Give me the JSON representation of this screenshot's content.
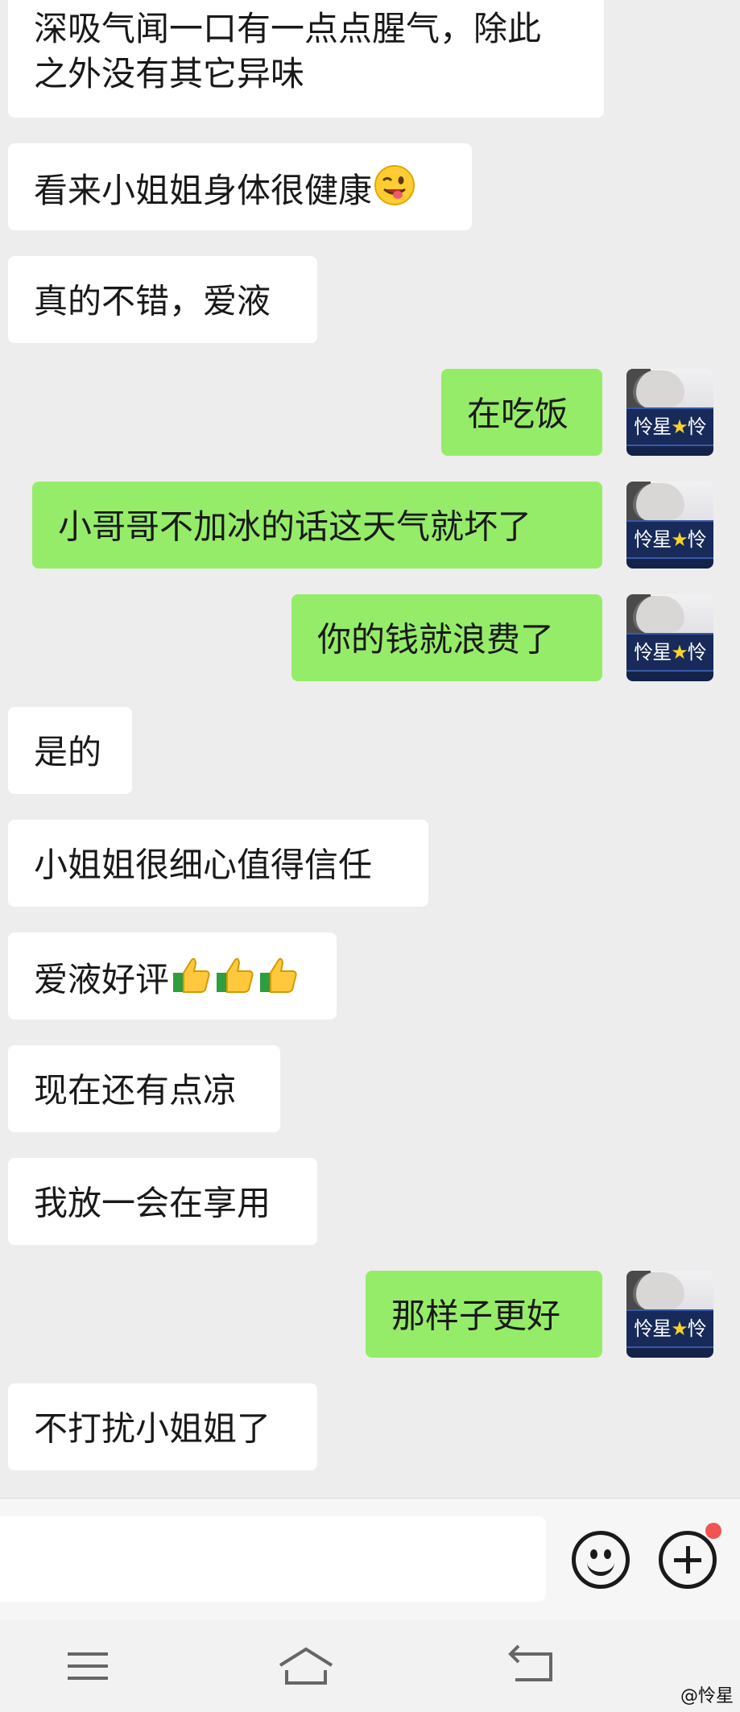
{
  "messages": [
    {
      "side": "in",
      "lines": [
        "深吸气闻一口有一点点腥气，除此",
        "之外没有其它异味"
      ],
      "emoji": null
    },
    {
      "side": "in",
      "lines": [
        "看来小姐姐身体很健康"
      ],
      "emoji": "winking-face-tongue-icon"
    },
    {
      "side": "in",
      "lines": [
        "真的不错，爱液"
      ],
      "emoji": null
    },
    {
      "side": "out",
      "lines": [
        "在吃饭"
      ],
      "emoji": null
    },
    {
      "side": "out",
      "lines": [
        "小哥哥不加冰的话这天气就坏了"
      ],
      "emoji": null
    },
    {
      "side": "out",
      "lines": [
        "你的钱就浪费了"
      ],
      "emoji": null
    },
    {
      "side": "in",
      "lines": [
        "是的"
      ],
      "emoji": null
    },
    {
      "side": "in",
      "lines": [
        "小姐姐很细心值得信任"
      ],
      "emoji": null
    },
    {
      "side": "in",
      "lines": [
        "爱液好评"
      ],
      "emoji": "thumbs-up-icon x3"
    },
    {
      "side": "in",
      "lines": [
        "现在还有点凉"
      ],
      "emoji": null
    },
    {
      "side": "in",
      "lines": [
        "我放一会在享用"
      ],
      "emoji": null
    },
    {
      "side": "out",
      "lines": [
        "那样子更好"
      ],
      "emoji": null
    },
    {
      "side": "in",
      "lines": [
        "不打扰小姐姐了"
      ],
      "emoji": null
    }
  ],
  "avatar": {
    "name_plate": "怜星",
    "star": "★",
    "tail": "怜"
  },
  "input": {
    "value": "",
    "placeholder": ""
  },
  "icons": {
    "emoji_button": "smiley-face-icon",
    "plus_button": "plus-circle-icon",
    "notification": "red-dot-badge",
    "nav": [
      "menu-icon",
      "home-icon",
      "back-icon"
    ]
  },
  "watermark": "@怜星",
  "colors": {
    "incoming": "#ffffff",
    "outgoing": "#95ec69",
    "background": "#ededed",
    "badge": "#f25353"
  }
}
